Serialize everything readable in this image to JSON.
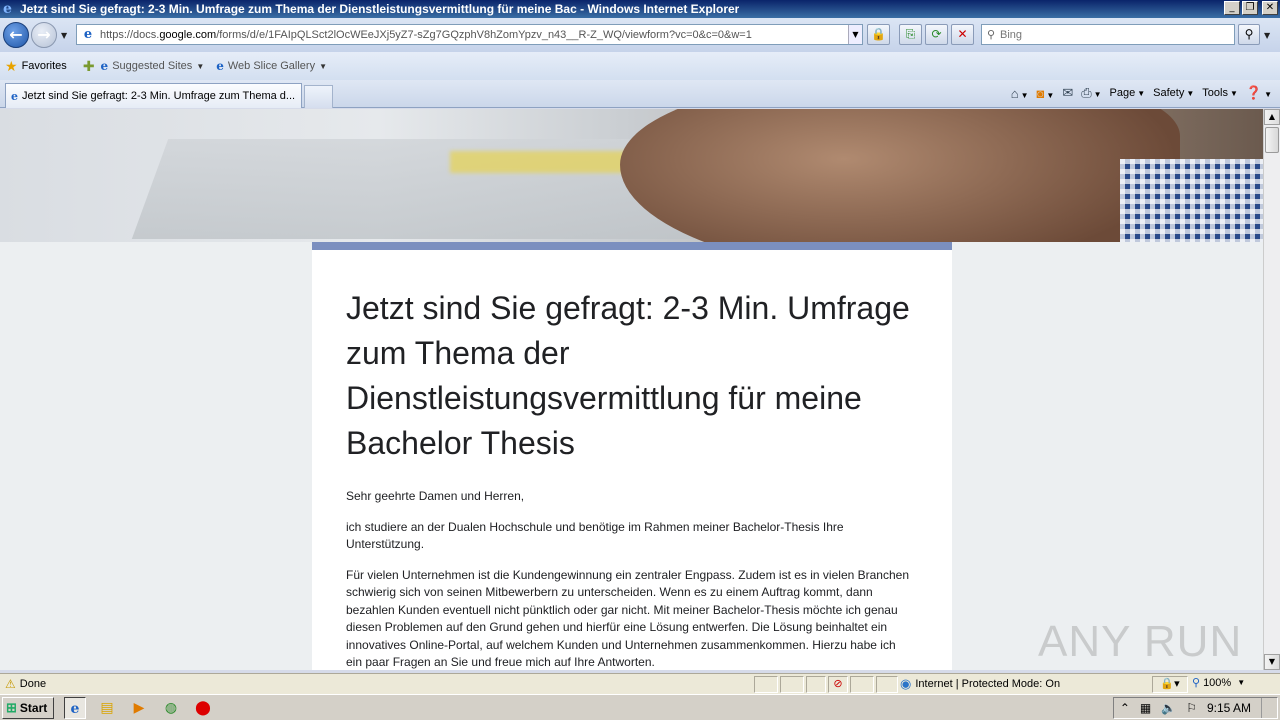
{
  "window": {
    "title": "Jetzt sind Sie gefragt: 2-3 Min. Umfrage zum Thema der Dienstleistungsvermittlung für meine Bac - Windows Internet Explorer"
  },
  "address_bar": {
    "url_prefix": "https://docs.",
    "url_domain": "google.com",
    "url_path": "/forms/d/e/1FAIpQLSct2lOcWEeJXj5yZ7-sZg7GQzphV8hZomYpzv_n43__R-Z_WQ/viewform?vc=0&c=0&w=1"
  },
  "search": {
    "placeholder": "Bing"
  },
  "favorites_bar": {
    "favorites_label": "Favorites",
    "items": [
      {
        "label": "Suggested Sites"
      },
      {
        "label": "Web Slice Gallery"
      }
    ]
  },
  "tabs": [
    {
      "title": "Jetzt sind Sie gefragt: 2-3 Min. Umfrage zum Thema d..."
    }
  ],
  "command_bar": {
    "page_label": "Page",
    "safety_label": "Safety",
    "tools_label": "Tools"
  },
  "form": {
    "title": "Jetzt sind Sie gefragt: 2-3 Min. Umfrage zum Thema der Dienstleistungsvermittlung für meine Bachelor Thesis",
    "paragraphs": [
      "Sehr geehrte Damen und Herren,",
      "ich studiere an der Dualen Hochschule und benötige im Rahmen meiner Bachelor-Thesis Ihre Unterstützung.",
      "Für vielen Unternehmen ist die Kundengewinnung ein zentraler Engpass. Zudem ist es in vielen Branchen schwierig sich von seinen Mitbewerbern zu unterscheiden. Wenn es zu einem Auftrag kommt, dann bezahlen Kunden eventuell nicht pünktlich oder gar nicht. Mit meiner Bachelor-Thesis möchte ich genau diesen Problemen auf den Grund gehen und hierfür eine Lösung entwerfen. Die Lösung beinhaltet ein innovatives Online-Portal, auf welchem Kunden und Unternehmen zusammenkommen. Hierzu habe ich ein paar Fragen an Sie und freue mich auf Ihre Antworten."
    ],
    "accent_color": "#7b8fbf"
  },
  "watermark": "ANY RUN",
  "status_bar": {
    "status_text": "Done",
    "zone_text": "Internet | Protected Mode: On",
    "zoom": "100%"
  },
  "taskbar": {
    "start_label": "Start",
    "clock": "9:15 AM"
  }
}
